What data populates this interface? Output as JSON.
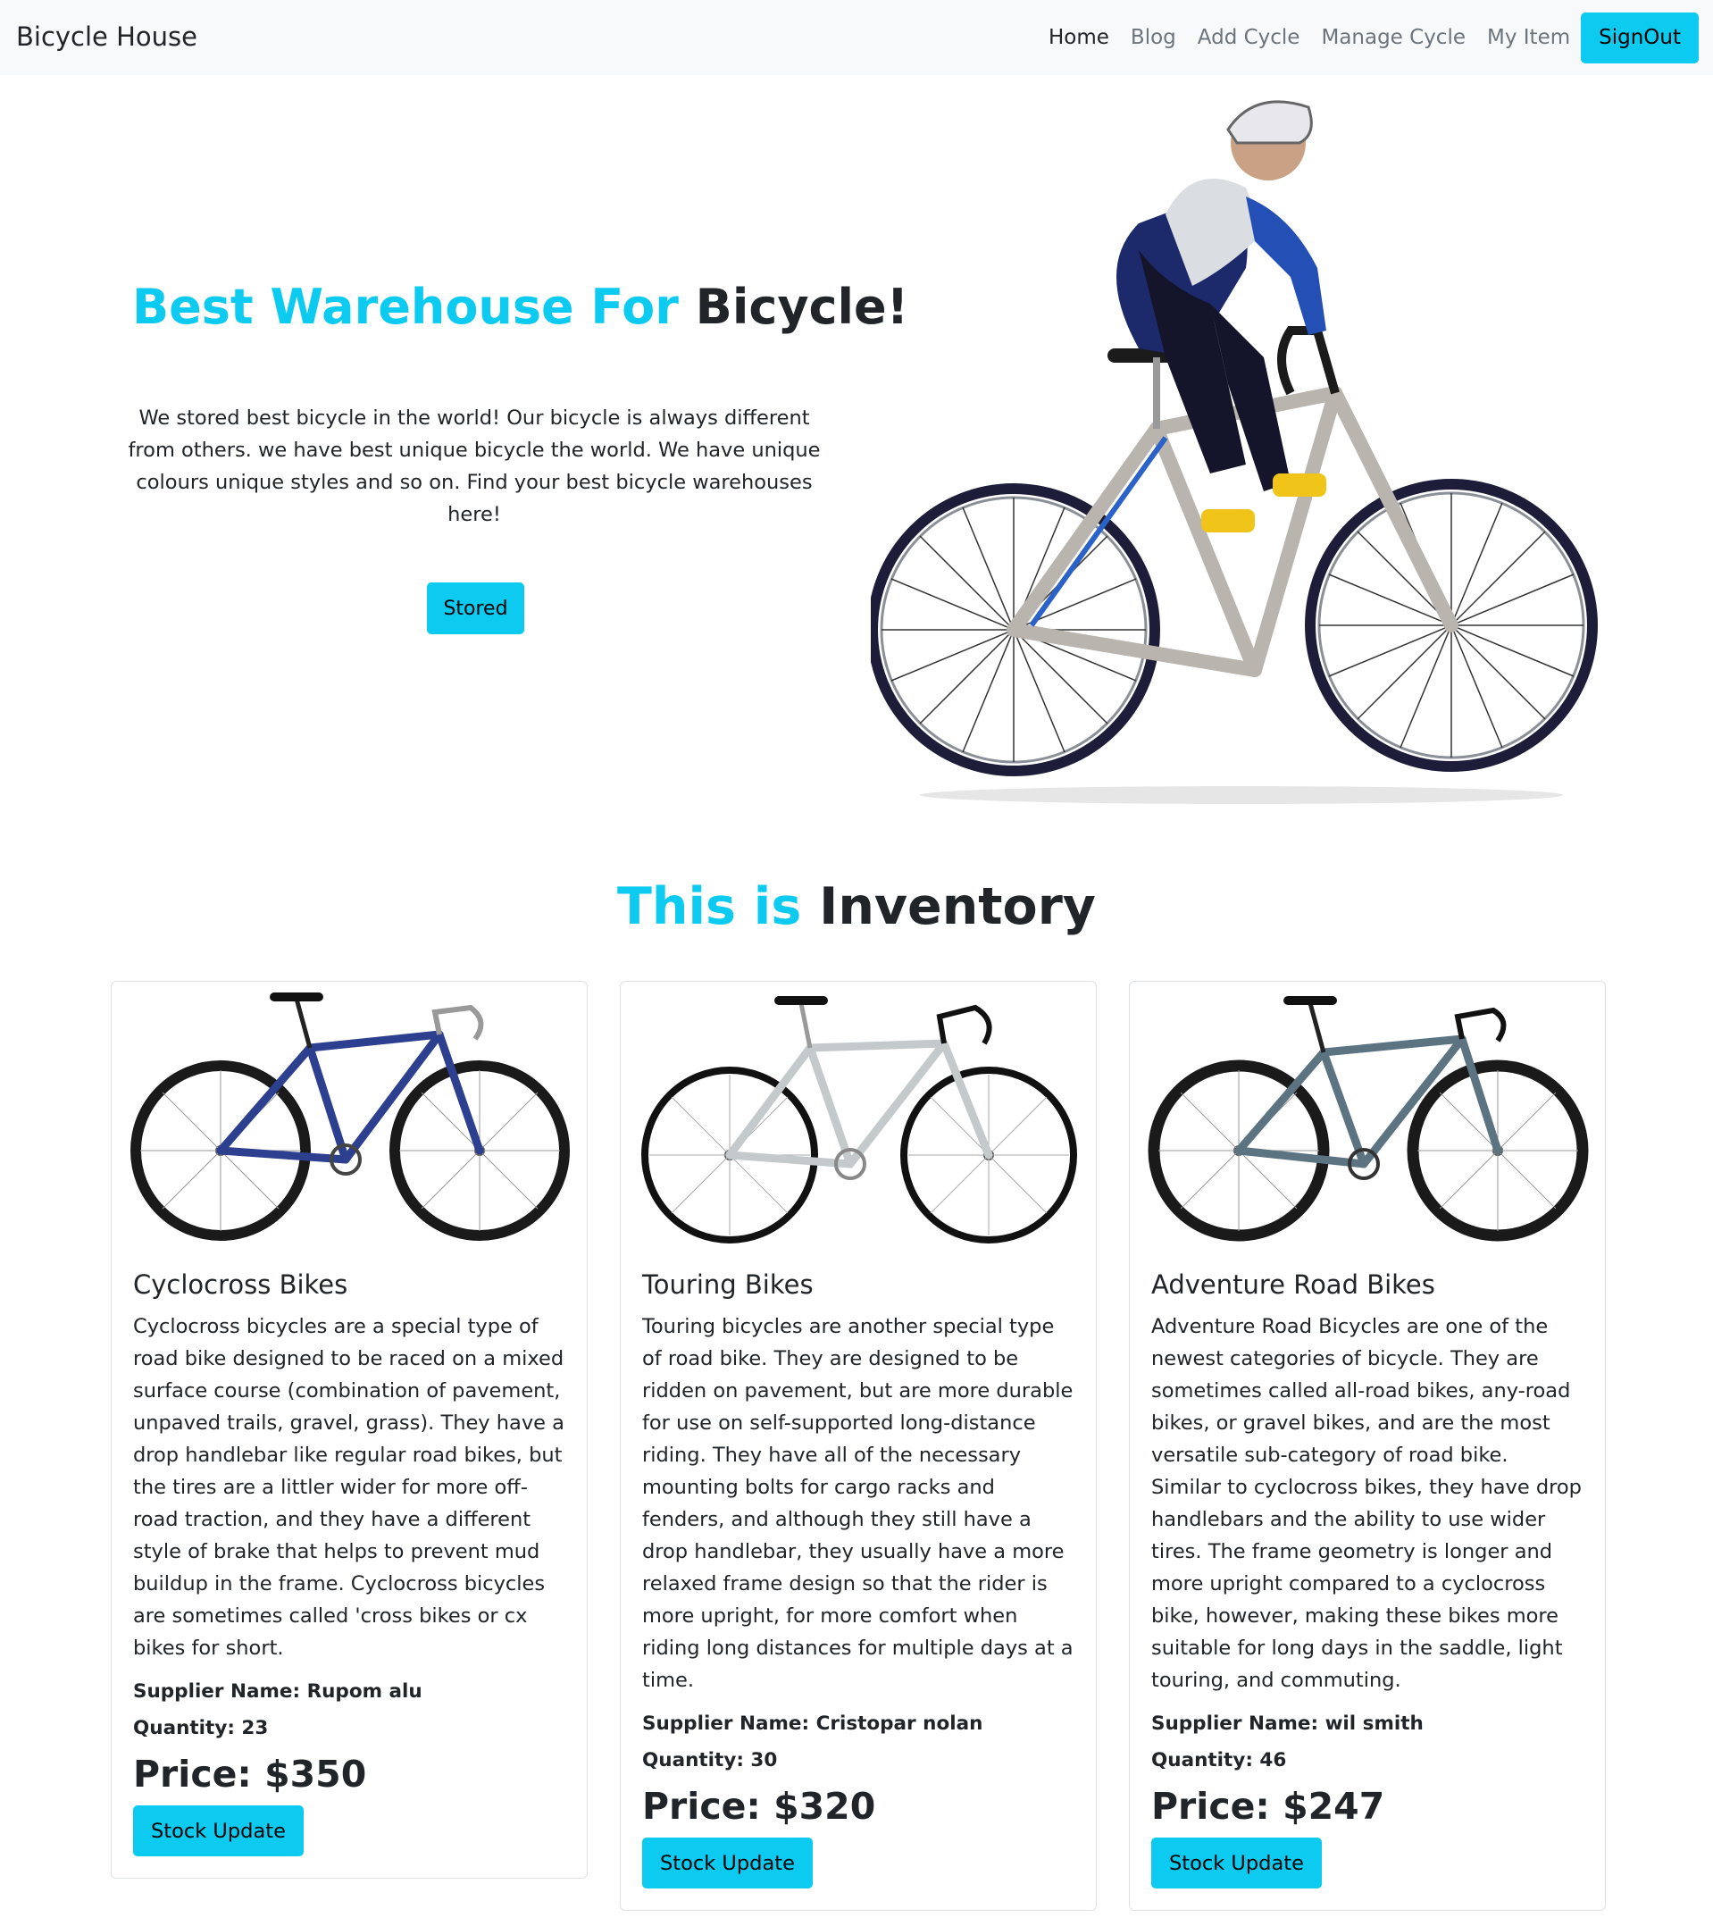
{
  "nav": {
    "brand": "Bicycle House",
    "links": [
      "Home",
      "Blog",
      "Add Cycle",
      "Manage Cycle",
      "My Item"
    ],
    "signout": "SignOut"
  },
  "hero": {
    "title_accent": "Best Warehouse For ",
    "title_strong": "Bicycle!",
    "text": "We stored best bicycle in the world! Our bicycle is always different from others. we have best unique bicycle the world. We have unique colours unique styles and so on. Find your best bicycle warehouses here!",
    "button": "Stored"
  },
  "inventory": {
    "title_accent": "This is ",
    "title_strong": "Inventory",
    "supplier_label": "Supplier Name: ",
    "quantity_label": "Quantity: ",
    "price_label": "Price: $",
    "button": "Stock Update",
    "items": [
      {
        "name": "Cyclocross Bikes",
        "description": "Cyclocross bicycles are a special type of road bike designed to be raced on a mixed surface course (combination of pavement, unpaved trails, gravel, grass). They have a drop handlebar like regular road bikes, but the tires are a littler wider for more off-road traction, and they have a different style of brake that helps to prevent mud buildup in the frame. Cyclocross bicycles are sometimes called 'cross bikes or cx bikes for short.",
        "supplier": "Rupom alu",
        "quantity": "23",
        "price": "350",
        "frame_color": "#2d3f8f"
      },
      {
        "name": "Touring Bikes",
        "description": "Touring bicycles are another special type of road bike. They are designed to be ridden on pavement, but are more durable for use on self-supported long-distance riding. They have all of the necessary mounting bolts for cargo racks and fenders, and although they still have a drop handlebar, they usually have a more relaxed frame design so that the rider is more upright, for more comfort when riding long distances for multiple days at a time.",
        "supplier": "Cristopar nolan",
        "quantity": "30",
        "price": "320",
        "frame_color": "#c4c9cc"
      },
      {
        "name": "Adventure Road Bikes",
        "description": "Adventure Road Bicycles are one of the newest categories of bicycle. They are sometimes called all-road bikes, any-road bikes, or gravel bikes, and are the most versatile sub-category of road bike. Similar to cyclocross bikes, they have drop handlebars and the ability to use wider tires. The frame geometry is longer and more upright compared to a cyclocross bike, however, making these bikes more suitable for long days in the saddle, light touring, and commuting.",
        "supplier": "wil smith",
        "quantity": "46",
        "price": "247",
        "frame_color": "#5c7482"
      }
    ]
  },
  "colors": {
    "accent": "#0dcaf0",
    "navbar_bg": "#f8f9fa",
    "text": "#212529",
    "muted": "#6c757d"
  }
}
